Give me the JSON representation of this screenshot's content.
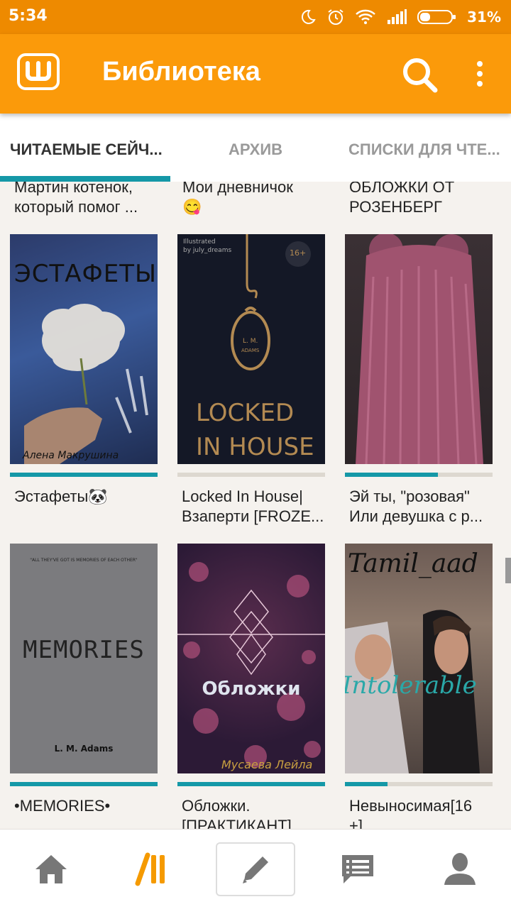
{
  "status_bar": {
    "time": "5:34",
    "battery_percent": "31%",
    "icons": [
      "moon-icon",
      "alarm-icon",
      "wifi-icon",
      "signal-icon",
      "battery-icon"
    ]
  },
  "app_bar": {
    "title": "Библиотека",
    "logo_icon": "wattpad-logo-icon",
    "actions": [
      "search-icon",
      "more-vert-icon"
    ]
  },
  "tabs": [
    {
      "label": "ЧИТАЕМЫЕ СЕЙЧ...",
      "active": true
    },
    {
      "label": "АРХИВ",
      "active": false
    },
    {
      "label": "СПИСКИ ДЛЯ ЧТЕ...",
      "active": false
    }
  ],
  "partial_row": [
    {
      "line1": "Мартин котенок,",
      "line2": "который помог ..."
    },
    {
      "line1": "Мои дневничок",
      "emoji": "😋"
    },
    {
      "line1": "ОБЛОЖКИ ОТ",
      "line2": "РОЗЕНБЕРГ"
    }
  ],
  "books": [
    {
      "title_line1": "Эстафеты🐼",
      "title_line2": "",
      "progress": 1.0,
      "cover": {
        "title": "ЭСТАФЕТЫ",
        "author": "Алена Макрушина"
      }
    },
    {
      "title_line1": "Locked In House|",
      "title_line2": "Взаперти [FROZE...",
      "progress": 0.0,
      "cover": {
        "illustrated": "Illustrated",
        "by": "by july_dreams",
        "age": "16+",
        "author": "L. M.",
        "author2": "ADAMS",
        "title1": "LOCKED",
        "title2": "IN HOUSE"
      }
    },
    {
      "title_line1": "Эй ты, \"розовая\"",
      "title_line2": "Или девушка с р...",
      "progress": 0.63,
      "cover": {}
    },
    {
      "title_line1": "•MEMORIES•",
      "title_line2": "",
      "progress": 1.0,
      "cover": {
        "quote": "\"ALL THEY'VE GOT IS MEMORIES OF EACH OTHER\"",
        "title": "MEMORIES",
        "author": "L. M. Adams"
      }
    },
    {
      "title_line1": "Обложки.",
      "title_line2": "[ПРАКТИКАНТ]",
      "progress": 1.0,
      "cover": {
        "title": "Обложки",
        "author": "Мусаева Лейла"
      }
    },
    {
      "title_line1": "Невыносимая[16",
      "title_line2": "+]",
      "progress": 0.29,
      "cover": {
        "top": "Tamil_aad",
        "script": "Intolerable"
      }
    }
  ],
  "bottom_nav": [
    "home-icon",
    "library-icon",
    "write-icon",
    "messages-icon",
    "profile-icon"
  ],
  "colors": {
    "orange": "#fb9a0a",
    "status_orange": "#ee8a00",
    "teal": "#1598a7",
    "library_orange": "#f59a00"
  }
}
